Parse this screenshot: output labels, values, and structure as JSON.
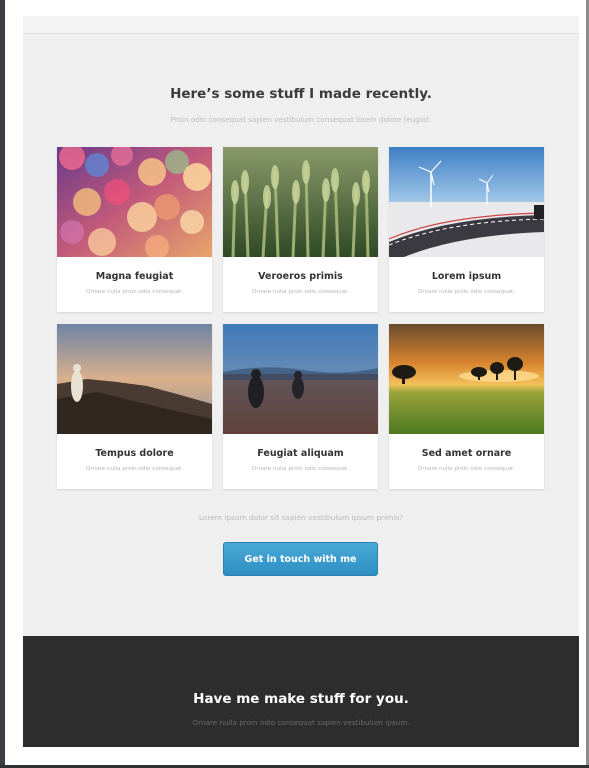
{
  "intro": {
    "heading": "Here’s some stuff I made recently.",
    "subheading": "Proin odio consequat sapien vestibulum consequat lorem dolore feugiat."
  },
  "gallery": [
    {
      "title": "Magna feugiat",
      "description": "Ornare nulla proin odio consequat.",
      "image": "bokeh-lights-image"
    },
    {
      "title": "Veroeros primis",
      "description": "Ornare nulla proin odio consequat.",
      "image": "wheat-field-image"
    },
    {
      "title": "Lorem ipsum",
      "description": "Ornare nulla proin odio consequat.",
      "image": "road-wind-turbines-image"
    },
    {
      "title": "Tempus dolore",
      "description": "Ornare nulla proin odio consequat.",
      "image": "cliff-figure-image"
    },
    {
      "title": "Feugiat aliquam",
      "description": "Ornare nulla proin odio consequat.",
      "image": "misty-field-figures-image"
    },
    {
      "title": "Sed amet ornare",
      "description": "Ornare nulla proin odio consequat.",
      "image": "sunset-savanna-image"
    }
  ],
  "cta": {
    "text": "Lorem ipsum dolor sit sapien vestibulum ipsum primis?",
    "button_label": "Get in touch with me"
  },
  "footer": {
    "title": "Have me make stuff for you.",
    "subtitle": "Ornare nulla proin odio consequat sapien vestibulum ipsum."
  },
  "colors": {
    "accent": "#3a9bcf",
    "page_background": "#efefef",
    "footer_background": "#2d2d2d"
  }
}
